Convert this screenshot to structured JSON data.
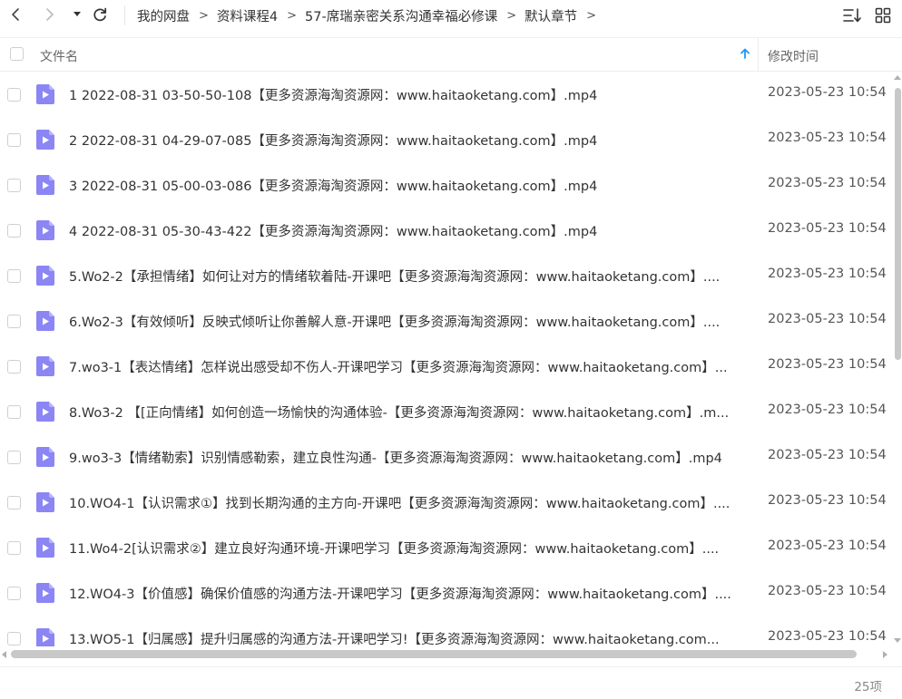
{
  "toolbar": {
    "back_icon": "chevron-left-icon",
    "forward_icon": "chevron-right-icon",
    "dropdown_icon": "caret-down-icon",
    "refresh_icon": "refresh-icon",
    "sort_icon": "sort-list-icon",
    "grid_icon": "grid-view-icon"
  },
  "breadcrumb": [
    "我的网盘",
    "资料课程4",
    "57-席瑞亲密关系沟通幸福必修课",
    "默认章节"
  ],
  "header": {
    "name_label": "文件名",
    "time_label": "修改时间"
  },
  "colors": {
    "file_icon": "#8b86f4",
    "accent": "#2196f3"
  },
  "files": [
    {
      "name": "1 2022-08-31 03-50-50-108【更多资源海淘资源网：www.haitaoketang.com】.mp4",
      "time": "2023-05-23 10:54"
    },
    {
      "name": "2 2022-08-31 04-29-07-085【更多资源海淘资源网：www.haitaoketang.com】.mp4",
      "time": "2023-05-23 10:54"
    },
    {
      "name": "3 2022-08-31 05-00-03-086【更多资源海淘资源网：www.haitaoketang.com】.mp4",
      "time": "2023-05-23 10:54"
    },
    {
      "name": "4 2022-08-31 05-30-43-422【更多资源海淘资源网：www.haitaoketang.com】.mp4",
      "time": "2023-05-23 10:54"
    },
    {
      "name": "5.Wo2-2【承担情绪】如何让对方的情绪软着陆-开课吧【更多资源海淘资源网：www.haitaoketang.com】....",
      "time": "2023-05-23 10:54"
    },
    {
      "name": "6.Wo2-3【有效倾听】反映式倾听让你善解人意-开课吧【更多资源海淘资源网：www.haitaoketang.com】....",
      "time": "2023-05-23 10:54"
    },
    {
      "name": "7.wo3-1【表达情绪】怎样说出感受却不伤人-开课吧学习【更多资源海淘资源网：www.haitaoketang.com】...",
      "time": "2023-05-23 10:54"
    },
    {
      "name": "8.Wo3-2 【[正向情绪】如何创造一场愉快的沟通体验-【更多资源海淘资源网：www.haitaoketang.com】.m...",
      "time": "2023-05-23 10:54"
    },
    {
      "name": "9.wo3-3【情绪勒索】识别情感勒索，建立良性沟通-【更多资源海淘资源网：www.haitaoketang.com】.mp4",
      "time": "2023-05-23 10:54"
    },
    {
      "name": "10.WO4-1【认识需求①】找到长期沟通的主方向-开课吧【更多资源海淘资源网：www.haitaoketang.com】....",
      "time": "2023-05-23 10:54"
    },
    {
      "name": "11.Wo4-2[认识需求②】建立良好沟通环境-开课吧学习【更多资源海淘资源网：www.haitaoketang.com】....",
      "time": "2023-05-23 10:54"
    },
    {
      "name": "12.WO4-3【价值感】确保价值感的沟通方法-开课吧学习【更多资源海淘资源网：www.haitaoketang.com】....",
      "time": "2023-05-23 10:54"
    },
    {
      "name": "13.WO5-1【归属感】提升归属感的沟通方法-开课吧学习!【更多资源海淘资源网：www.haitaoketang.com...",
      "time": "2023-05-23 10:54"
    }
  ],
  "footer": {
    "count": "25项"
  }
}
